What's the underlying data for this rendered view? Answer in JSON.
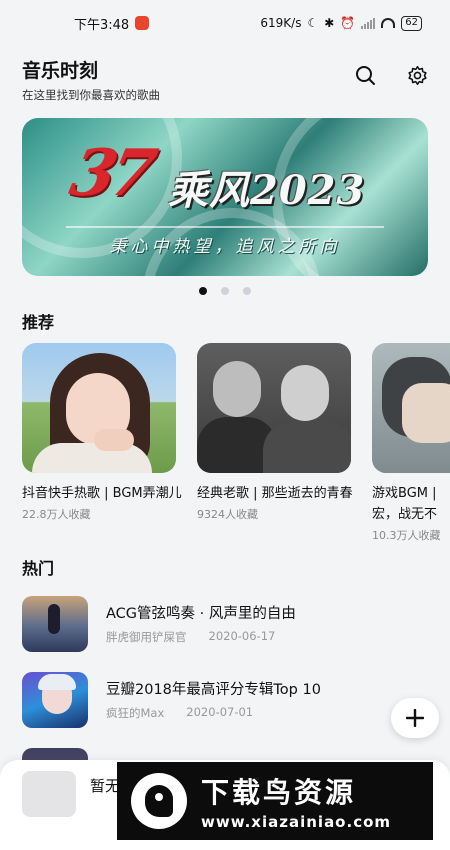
{
  "status_bar": {
    "time": "下午3:48",
    "network_speed": "619K/s",
    "battery": "62"
  },
  "header": {
    "title": "音乐时刻",
    "subtitle": "在这里找到你最喜欢的歌曲",
    "search_icon": "search-icon",
    "settings_icon": "gear-icon"
  },
  "banner": {
    "number": "37",
    "title": "乘风2023",
    "slogan": "秉心中热望，追风之所向",
    "page_count": 3,
    "active_page": 1
  },
  "recommend": {
    "title": "推荐",
    "items": [
      {
        "name": "抖音快手热歌 | BGM弄潮儿",
        "meta": "22.8万人收藏"
      },
      {
        "name": "经典老歌 | 那些逝去的青春",
        "meta": "9324人收藏"
      },
      {
        "name": "游戏BGM | 宏，战无不",
        "meta": "10.3万人收藏"
      }
    ]
  },
  "hot": {
    "title": "热门",
    "items": [
      {
        "title": "ACG管弦鸣奏 · 风声里的自由",
        "author": "胖虎御用铲屎官",
        "date": "2020-06-17"
      },
      {
        "title": "豆瓣2018年最高评分专辑Top 10",
        "author": "疯狂的Max",
        "date": "2020-07-01"
      }
    ]
  },
  "fab": {
    "label": "+"
  },
  "player": {
    "text": "暂无"
  },
  "watermark": {
    "main": "下载鸟资源",
    "url": "www.xiazainiao.com"
  }
}
